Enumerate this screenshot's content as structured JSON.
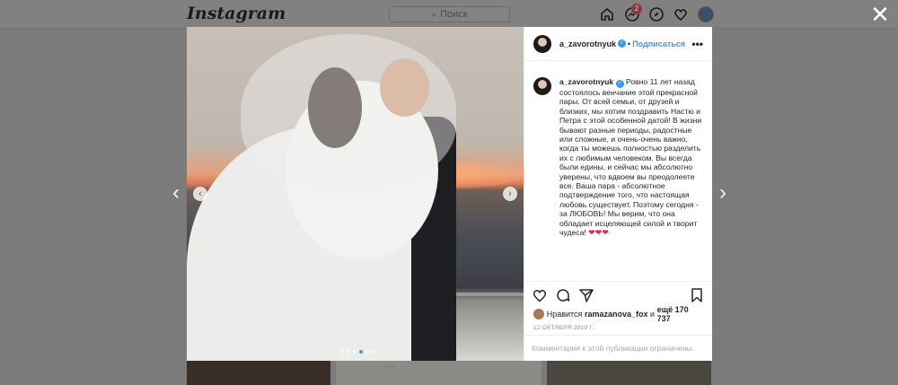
{
  "header": {
    "logo": "Instagram",
    "search_placeholder": "Поиск",
    "notifications_count": "2"
  },
  "post": {
    "username": "a_zavorotnyuk",
    "follow_label": "Подписаться",
    "separator": "•",
    "caption": "Ровно 11 лет назад состоялось венчание этой прекрасной пары. От всей семьи, от друзей и близких, мы хотим поздравить Настю и Петра с этой особенной датой! В жизни бывают разные периоды, радостные или сложные, и очень-очень важно, когда ты можешь полностью разделить их с любимым человеком. Вы всегда были едины, и сейчас мы абсолютно уверены, что вдвоем вы преодолеете все. Ваша пара - абсолютное подтверждение того, что настоящая любовь существует. Поэтому сегодня - за ЛЮБОВЬ! Мы верим, что она обладает исцеляющей силой и творит чудеса!",
    "caption_hearts": "❤❤❤",
    "likes_prefix": "Нравится",
    "likes_user": "ramazanova_fox",
    "likes_and": "и",
    "likes_others": "ещё 170 737",
    "date": "12 ОКТЯБРЯ 2019 Г.",
    "comments_disabled": "Комментарии к этой публикации ограничены.",
    "carousel_slides": 6,
    "carousel_active": 4
  },
  "feed_behind_text": "……"
}
